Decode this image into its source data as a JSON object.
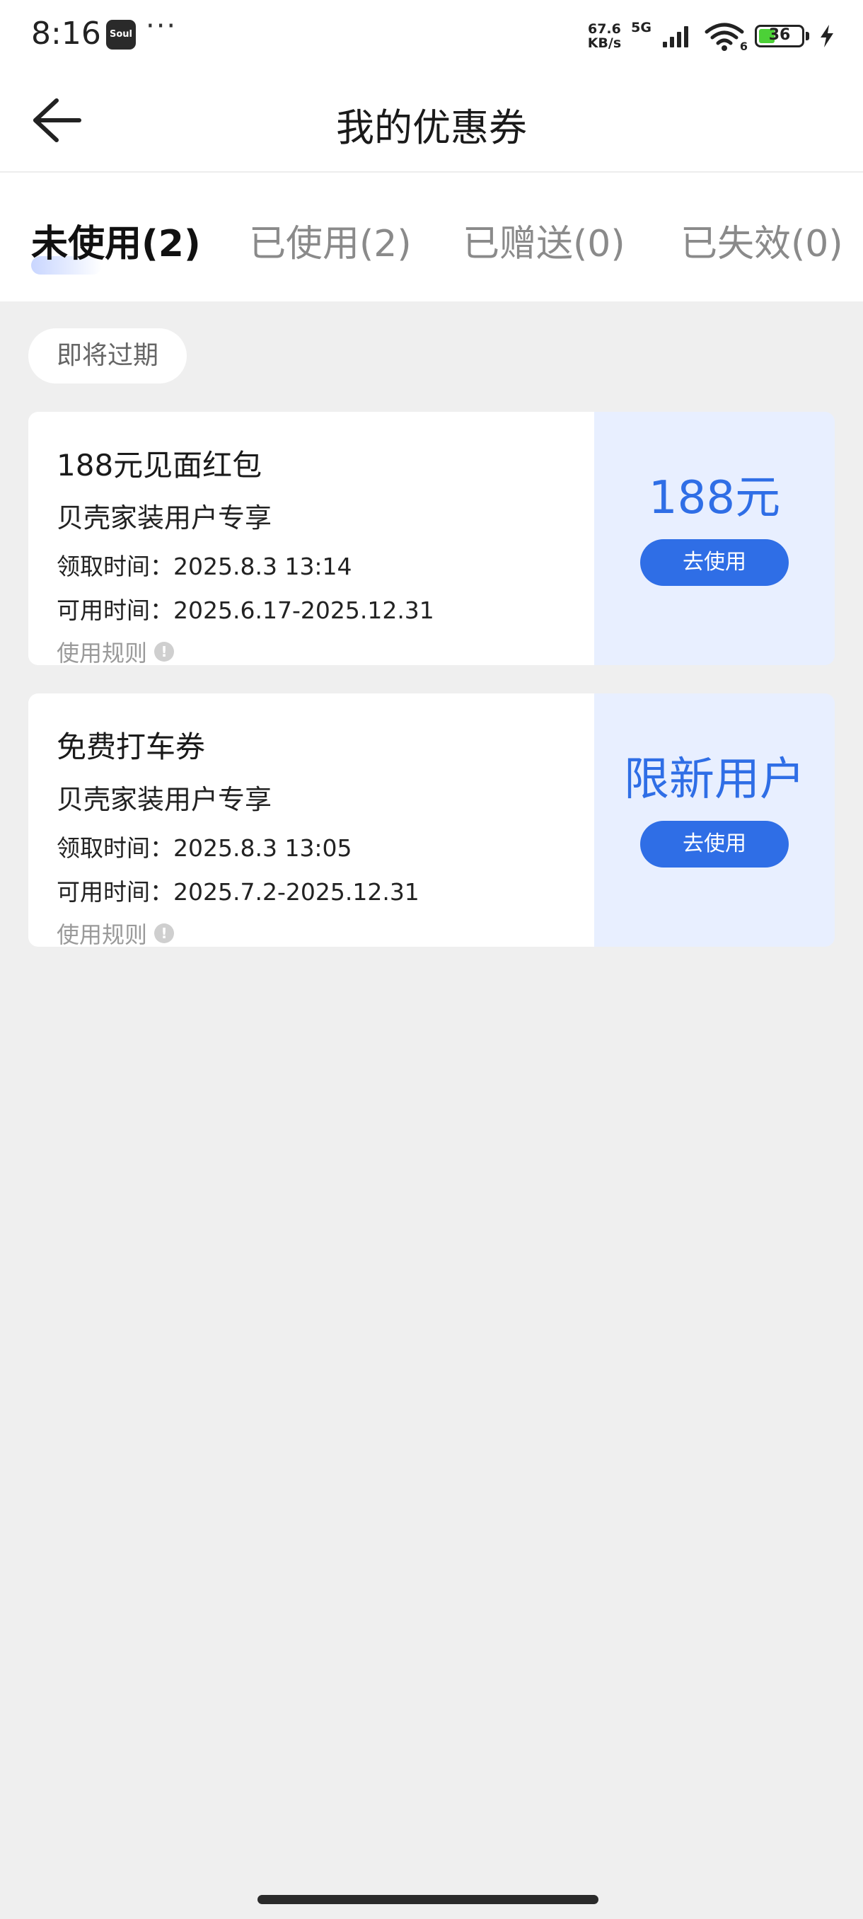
{
  "status_bar": {
    "time": "8:16",
    "app_badge": "Soul",
    "more": "···",
    "net_speed_value": "67.6",
    "net_speed_unit": "KB/s",
    "network": "5G",
    "wifi_sub": "6",
    "battery": "36"
  },
  "header": {
    "title": "我的优惠券"
  },
  "tabs": [
    {
      "label": "未使用(2)",
      "active": true
    },
    {
      "label": "已使用(2)",
      "active": false
    },
    {
      "label": "已赠送(0)",
      "active": false
    },
    {
      "label": "已失效(0)",
      "active": false
    }
  ],
  "section": {
    "chip_label": "即将过期"
  },
  "coupons": [
    {
      "title": "188元见面红包",
      "subtitle": "贝壳家装用户专享",
      "receive_time": "领取时间：2025.8.3 13:14",
      "valid_time": "可用时间：2025.6.17-2025.12.31",
      "rules": "使用规则",
      "value": "188元",
      "button": "去使用"
    },
    {
      "title": "免费打车券",
      "subtitle": "贝壳家装用户专享",
      "receive_time": "领取时间：2025.8.3 13:05",
      "valid_time": "可用时间：2025.7.2-2025.12.31",
      "rules": "使用规则",
      "value": "限新用户",
      "button": "去使用"
    }
  ],
  "colors": {
    "accent": "#2f6ee6",
    "coupon_right_bg": "#e8efff",
    "page_bg": "#efefef"
  }
}
